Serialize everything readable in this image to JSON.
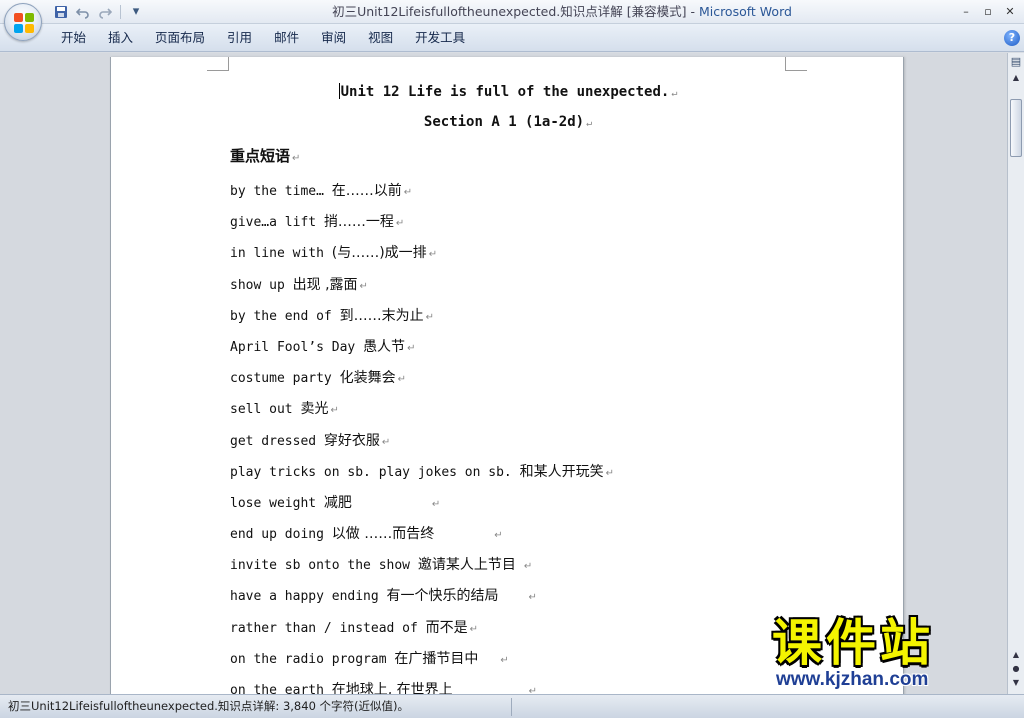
{
  "window": {
    "title": "初三Unit12Lifeisfulloftheunexpected.知识点详解 [兼容模式] - ",
    "app_name": "Microsoft Word",
    "controls": {
      "minimize": "–",
      "restore": "▫",
      "close": "✕"
    }
  },
  "quick_access": {
    "save_icon": "save-icon",
    "undo_icon": "undo-icon",
    "redo_icon": "redo-icon",
    "customize": "▾"
  },
  "ribbon": {
    "tabs": [
      "开始",
      "插入",
      "页面布局",
      "引用",
      "邮件",
      "审阅",
      "视图",
      "开发工具"
    ],
    "help": "?"
  },
  "document": {
    "title": "Unit 12 Life is full of the unexpected.",
    "subtitle": "Section A 1 (1a-2d)",
    "heading": "重点短语",
    "paragraph_mark": "↵",
    "phrases": [
      {
        "en": "by the time… ",
        "zh": "在……以前"
      },
      {
        "en": "give…a lift    ",
        "zh": "捎……一程"
      },
      {
        "en": "in line with   ",
        "zh": "(与……)成一排"
      },
      {
        "en": "show up     ",
        "zh": "出现 ,露面"
      },
      {
        "en": "by the end of  ",
        "zh": "到……末为止"
      },
      {
        "en": "April Fool’s Day  ",
        "zh": "愚人节"
      },
      {
        "en": "costume party  ",
        "zh": "化装舞会"
      },
      {
        "en": "sell out   ",
        "zh": "卖光"
      },
      {
        "en": "get dressed ",
        "zh": "穿好衣服"
      },
      {
        "en": "play tricks on sb.  play jokes on sb. ",
        "zh": "和某人开玩笑"
      },
      {
        "en": "lose weight  ",
        "zh": "减肥"
      },
      {
        "en": "end up doing ",
        "zh": "以做 ……而告终"
      },
      {
        "en": "invite sb onto the show  ",
        "zh": "邀请某人上节目"
      },
      {
        "en": "have a happy ending ",
        "zh": "有一个快乐的结局"
      },
      {
        "en": "rather than / instead of  ",
        "zh": "而不是"
      },
      {
        "en": "on the radio program  ",
        "zh": "在广播节目中"
      },
      {
        "en": "on the earth  ",
        "zh": "在地球上, 在世界上"
      }
    ]
  },
  "statusbar": {
    "text": "初三Unit12Lifeisfulloftheunexpected.知识点详解: 3,840 个字符(近似值)。"
  },
  "watermark": {
    "title": "课件站",
    "url": "www.kjzhan.com"
  },
  "colors": {
    "office_logo": [
      "#f25022",
      "#7fba00",
      "#00a4ef",
      "#ffb900"
    ],
    "accent": "#2b5797",
    "watermark_yellow": "#f4f400"
  }
}
